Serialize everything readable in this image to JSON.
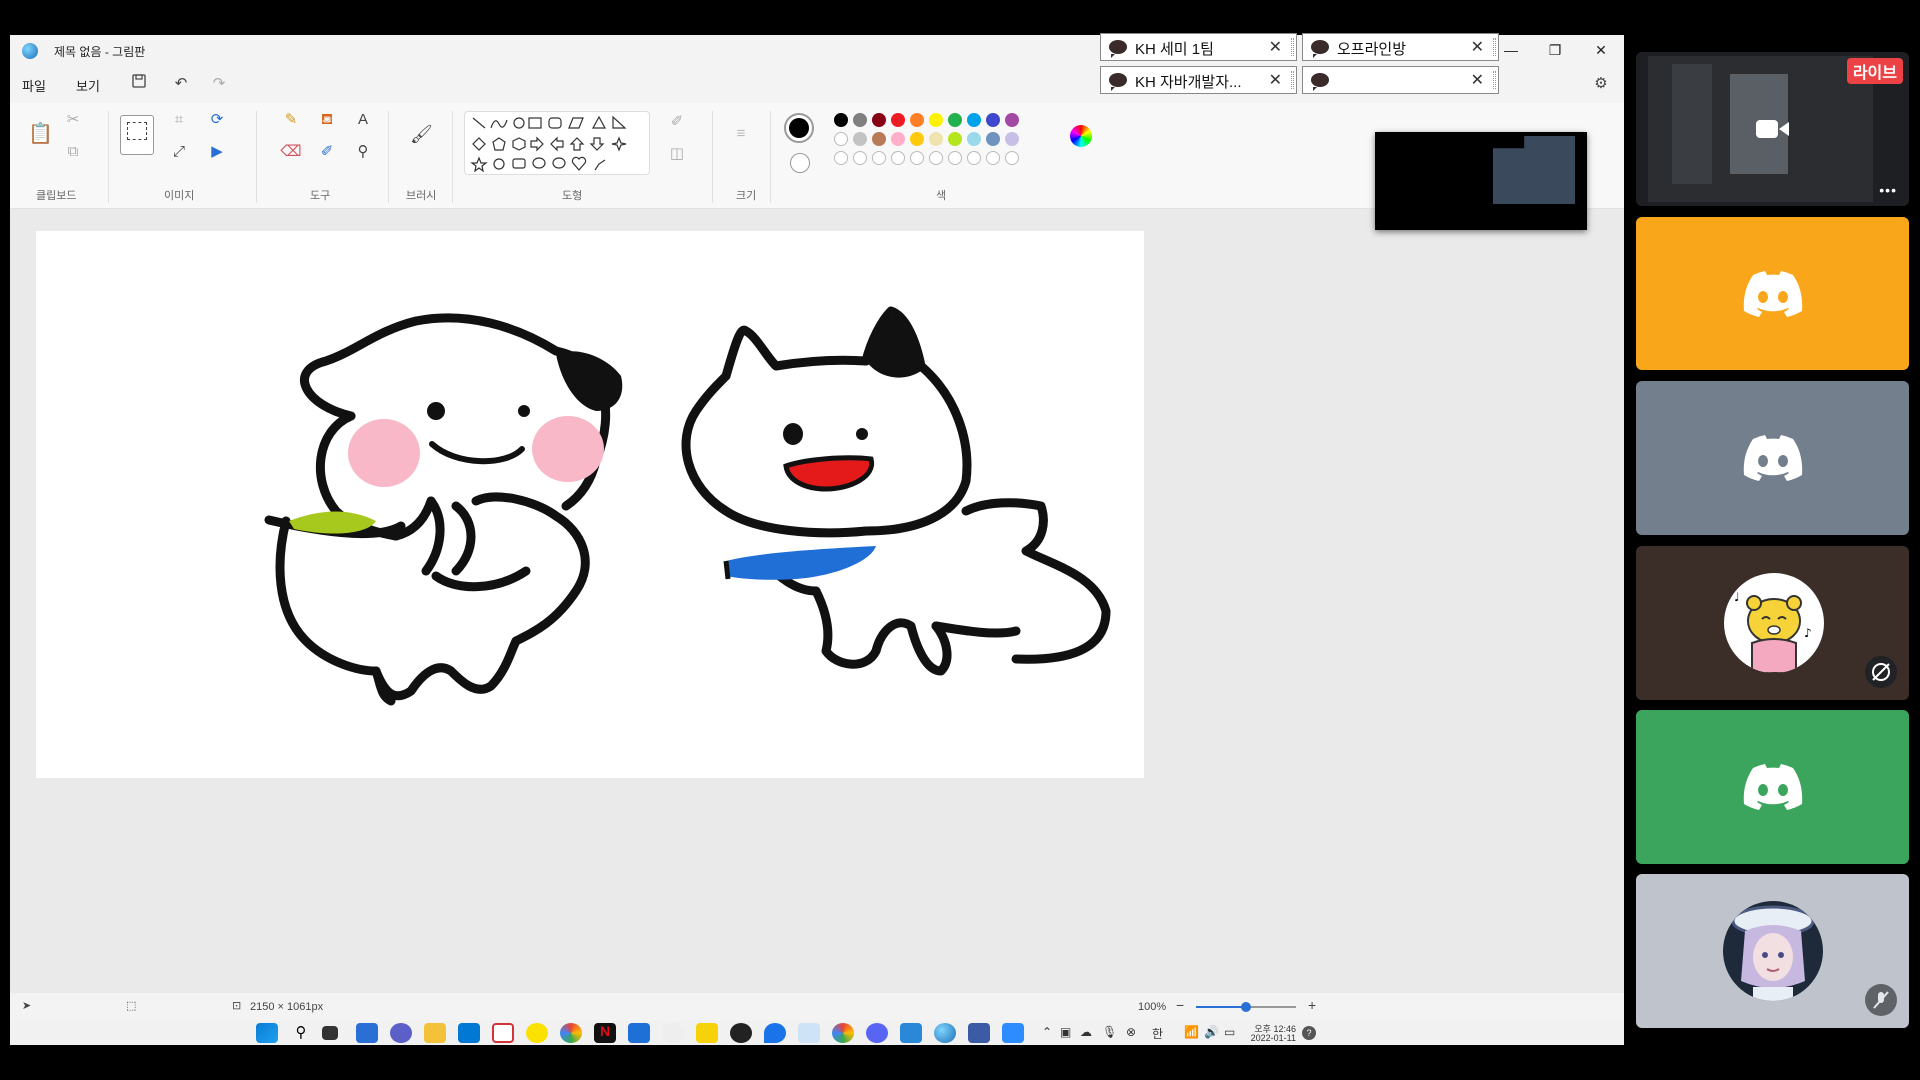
{
  "window": {
    "title": "제목 없음 - 그림판",
    "controls": {
      "minimize": "—",
      "restore": "❐",
      "close": "✕"
    }
  },
  "chat_tabs": [
    {
      "label": "KH 세미 1팀"
    },
    {
      "label": "오프라인방"
    },
    {
      "label": "KH 자바개발자..."
    },
    {
      "label": ""
    }
  ],
  "menu": {
    "file": "파일",
    "view": "보기"
  },
  "ribbon": {
    "groups": {
      "clipboard": "클립보드",
      "image": "이미지",
      "tools": "도구",
      "brushes": "브러시",
      "shapes": "도형",
      "size": "크기",
      "colors": "색"
    }
  },
  "palette": {
    "primary": "#000000",
    "secondary": "#ffffff",
    "row1": [
      "#000000",
      "#7f7f7f",
      "#880015",
      "#ed1c24",
      "#ff7f27",
      "#fff200",
      "#22b14c",
      "#00a2e8",
      "#3f48cc",
      "#a349a4"
    ],
    "row2": [
      "#ffffff",
      "#c3c3c3",
      "#b97a57",
      "#ffaec9",
      "#ffc90e",
      "#efe4b0",
      "#b5e61d",
      "#99d9ea",
      "#7092be",
      "#c8bfe7"
    ]
  },
  "status": {
    "canvas_size": "2150 × 1061px",
    "zoom": "100%",
    "zoom_level": 0.5
  },
  "taskbar": {
    "ime": "한",
    "time": "오후 12:46",
    "date": "2022-01-11"
  },
  "side_panel": {
    "live_badge": "라이브",
    "tiles": [
      {
        "type": "screen-share",
        "more": "•••"
      },
      {
        "type": "discord-avatar",
        "color": "#faa61a"
      },
      {
        "type": "discord-avatar",
        "color": "#747f8d"
      },
      {
        "type": "custom-avatar",
        "color": "#3b2e28",
        "muted": true
      },
      {
        "type": "discord-avatar",
        "color": "#3ba55d"
      },
      {
        "type": "custom-avatar",
        "color": "#bfc4cc",
        "muted": true
      }
    ]
  }
}
